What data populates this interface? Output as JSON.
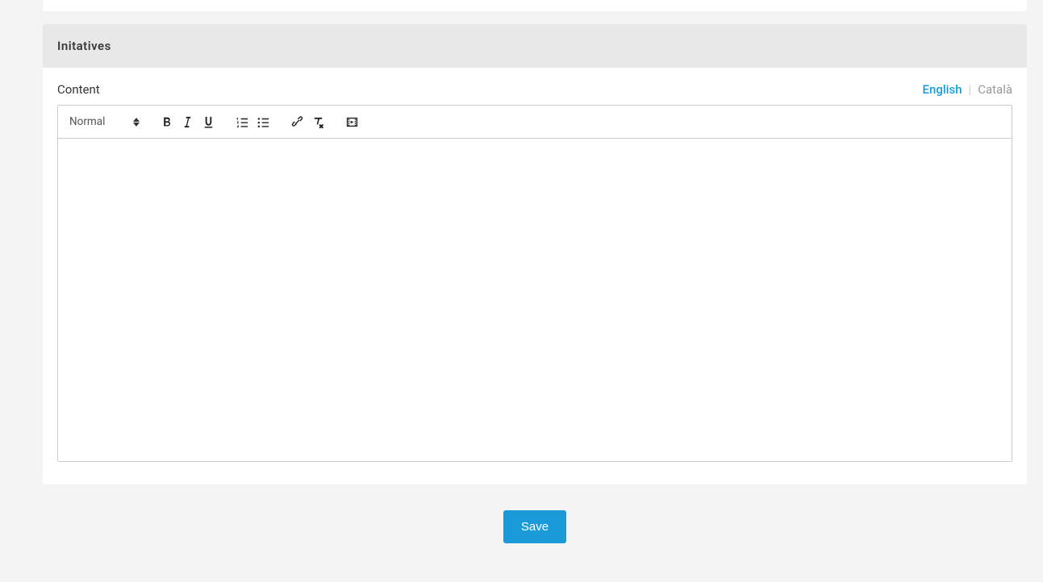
{
  "section": {
    "title": "Initatives"
  },
  "editor": {
    "label": "Content",
    "format_select": "Normal",
    "languages": {
      "active": "English",
      "inactive": "Català",
      "separator": "|"
    }
  },
  "actions": {
    "save_label": "Save"
  }
}
